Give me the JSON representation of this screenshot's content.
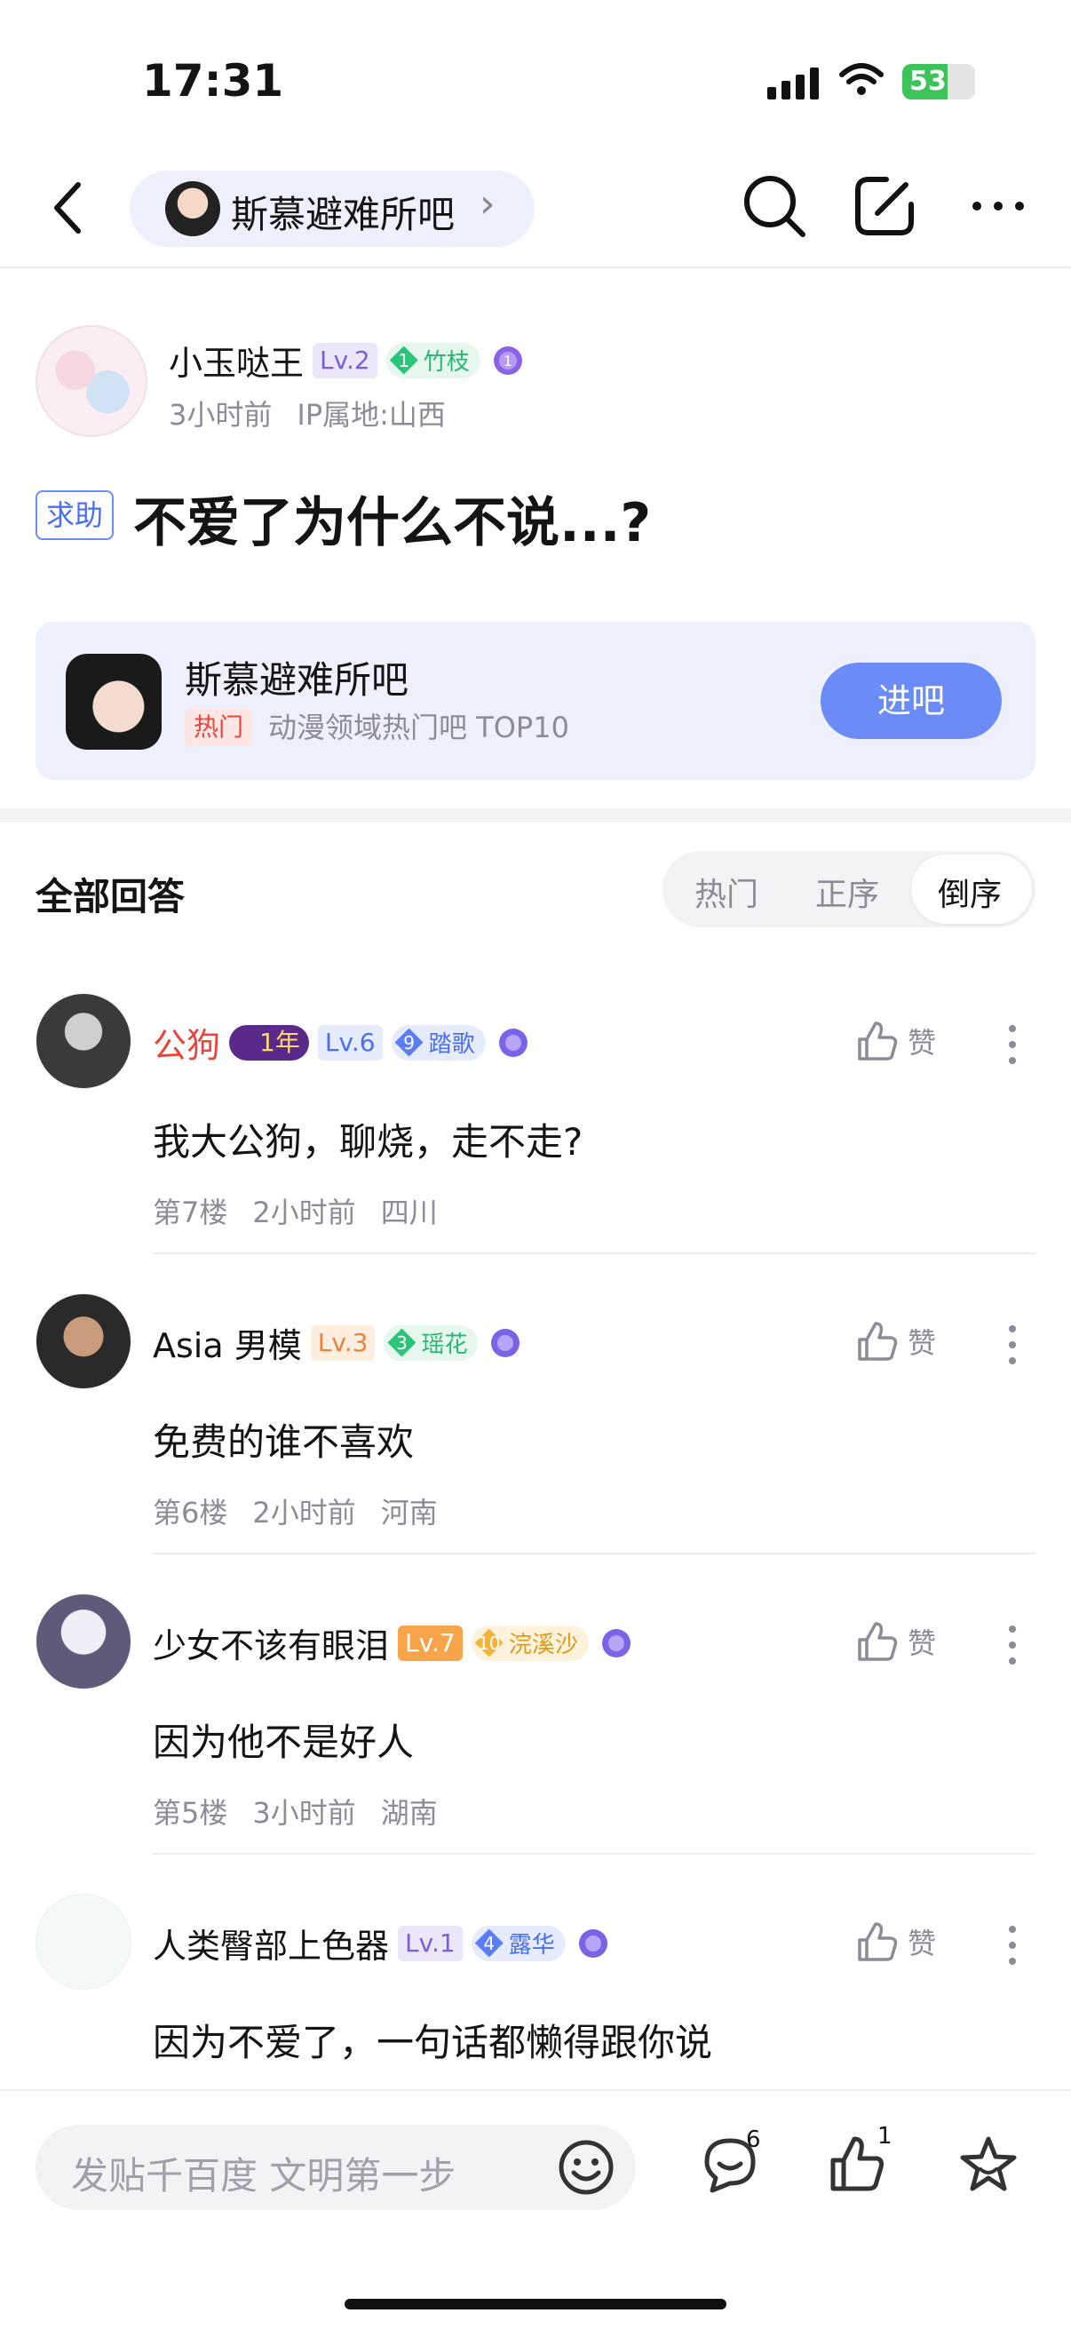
{
  "status_bar": {
    "time": "17:31",
    "battery": "53"
  },
  "nav": {
    "forum_name": "斯慕避难所吧",
    "chevron": "›",
    "icons": [
      "back-icon",
      "search-icon",
      "edit-icon",
      "more-icon"
    ]
  },
  "post": {
    "author": "小玉哒王",
    "level": "Lv.2",
    "badge_num": "1",
    "badge_name": "竹枝",
    "time": "3小时前",
    "ip": "IP属地:山西",
    "tag": "求助",
    "title": "不爱了为什么不说...?"
  },
  "forum_card": {
    "name": "斯慕避难所吧",
    "hot_tag": "热门",
    "desc": "动漫领域热门吧 TOP10",
    "join_label": "进吧"
  },
  "answers_header": {
    "title": "全部回答",
    "sort_options": [
      "热门",
      "正序",
      "倒序"
    ],
    "selected": "倒序"
  },
  "comments": [
    {
      "name": "公狗",
      "name_color": "#e8453c",
      "year_badge": "1年",
      "level": "Lv.6",
      "level_style": "blue",
      "badge_num": "9",
      "badge_name": "踏歌",
      "badge_style": "blue",
      "content": "我大公狗，聊烧，走不走?",
      "floor": "第7楼",
      "time": "2小时前",
      "location": "四川",
      "like": "赞"
    },
    {
      "name": "Asia 男模",
      "name_color": "#141414",
      "level": "Lv.3",
      "level_style": "orange",
      "badge_num": "3",
      "badge_name": "瑶花",
      "badge_style": "green",
      "content": "免费的谁不喜欢",
      "floor": "第6楼",
      "time": "2小时前",
      "location": "河南",
      "like": "赞"
    },
    {
      "name": "少女不该有眼泪",
      "name_color": "#141414",
      "level": "Lv.7",
      "level_style": "orange-solid",
      "badge_num": "10",
      "badge_name": "浣溪沙",
      "badge_style": "gold",
      "content": "因为他不是好人",
      "floor": "第5楼",
      "time": "3小时前",
      "location": "湖南",
      "like": "赞"
    },
    {
      "name": "人类臀部上色器",
      "name_color": "#141414",
      "level": "Lv.1",
      "level_style": "purple",
      "badge_num": "4",
      "badge_name": "露华",
      "badge_style": "blue",
      "content": "因为不爱了，一句话都懒得跟你说",
      "floor": "",
      "time": "",
      "location": "",
      "like": "赞"
    }
  ],
  "bottom_bar": {
    "input_placeholder": "发贴千百度 文明第一步",
    "comment_count": "6",
    "like_count": "1"
  },
  "colors": {
    "accent": "#6b8cf7",
    "card_bg": "#eef1fd",
    "hot_red": "#e8453c"
  }
}
